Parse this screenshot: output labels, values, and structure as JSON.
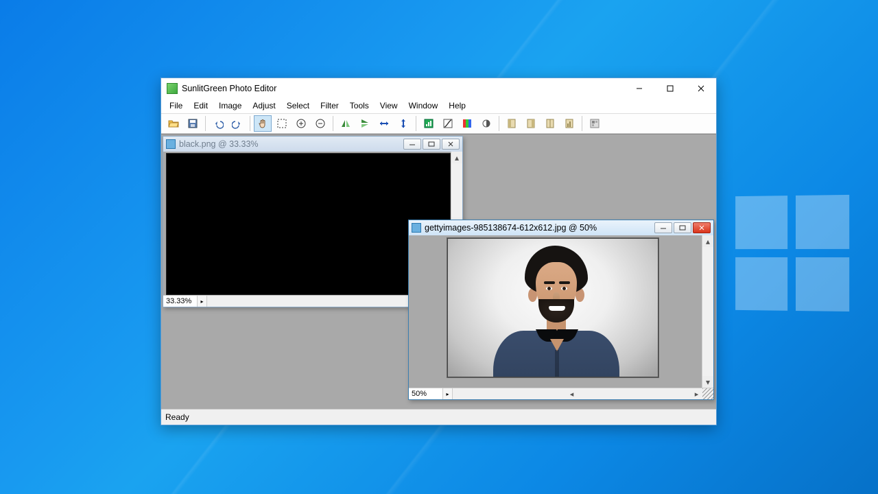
{
  "app": {
    "title": "SunlitGreen Photo Editor"
  },
  "menu": {
    "file": "File",
    "edit": "Edit",
    "image": "Image",
    "adjust": "Adjust",
    "select": "Select",
    "filter": "Filter",
    "tools": "Tools",
    "view": "View",
    "window": "Window",
    "help": "Help"
  },
  "status": {
    "text": "Ready"
  },
  "documents": {
    "doc1": {
      "title": "black.png @ 33.33%",
      "zoom": "33.33%",
      "active": false
    },
    "doc2": {
      "title": "gettyimages-985138674-612x612.jpg @ 50%",
      "zoom": "50%",
      "active": true
    }
  },
  "toolbar_icons": {
    "open": "open-icon",
    "save": "save-icon",
    "undo": "undo-icon",
    "redo": "redo-icon",
    "hand": "hand-tool-icon",
    "marquee": "selection-tool-icon",
    "zoomin": "zoom-in-icon",
    "zoomout": "zoom-out-icon",
    "fliph": "flip-horizontal-icon",
    "flipv": "flip-vertical-icon",
    "resizeh": "resize-horizontal-icon",
    "resizev": "resize-vertical-icon",
    "levels": "levels-icon",
    "curves": "curves-icon",
    "huesat": "hue-saturation-icon",
    "brightness": "brightness-contrast-icon",
    "r1": "rotate-left-icon",
    "r2": "rotate-right-icon",
    "r3": "layout-icon",
    "r4": "histogram-icon",
    "thumbs": "thumbnails-icon"
  }
}
